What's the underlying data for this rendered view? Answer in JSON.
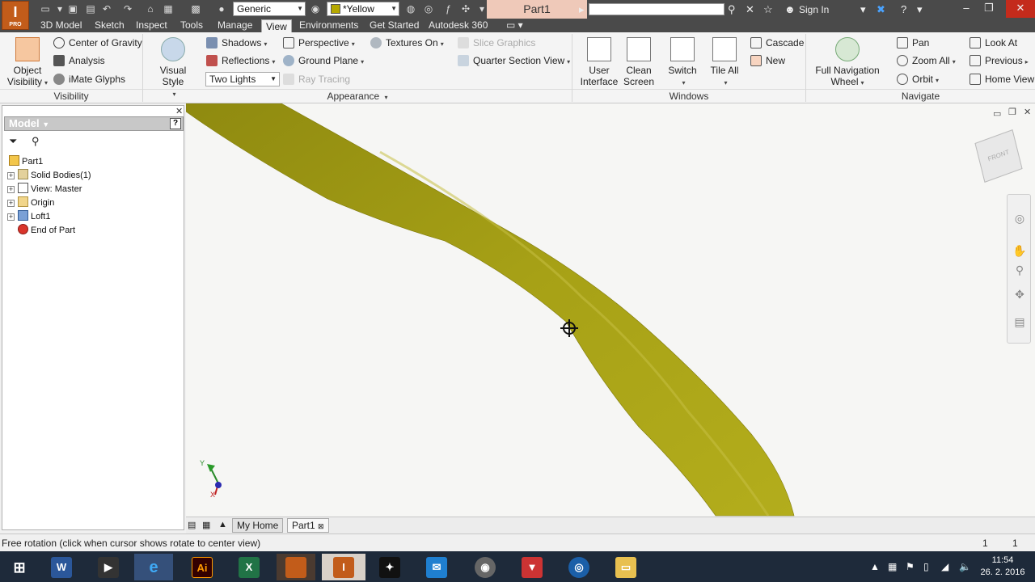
{
  "app": {
    "logo_text": "I",
    "logo_sub": "PRO"
  },
  "quick_access": {
    "material_combo": "Generic",
    "appearance_combo": "*Yellow",
    "appearance_color": "#b5a800"
  },
  "title": {
    "document": "Part1",
    "sign_in": "Sign In"
  },
  "tabs": [
    "3D Model",
    "Sketch",
    "Inspect",
    "Tools",
    "Manage",
    "View",
    "Environments",
    "Get Started",
    "Autodesk 360"
  ],
  "active_tab": "View",
  "ribbon": {
    "visibility": {
      "label": "Visibility",
      "object_visibility": "Object Visibility",
      "center_of_gravity": "Center of Gravity",
      "analysis": "Analysis",
      "imate_glyphs": "iMate Glyphs"
    },
    "appearance": {
      "label": "Appearance",
      "visual_style": "Visual Style",
      "shadows": "Shadows",
      "reflections": "Reflections",
      "lighting": "Two Lights",
      "perspective": "Perspective",
      "ground_plane": "Ground Plane",
      "ray_tracing": "Ray Tracing",
      "textures_on": "Textures On",
      "slice_graphics": "Slice Graphics",
      "quarter_section_view": "Quarter Section View"
    },
    "windows": {
      "label": "Windows",
      "user_interface": "User Interface",
      "clean_screen": "Clean Screen",
      "switch": "Switch",
      "tile_all": "Tile All",
      "cascade": "Cascade",
      "new": "New"
    },
    "navigate": {
      "label": "Navigate",
      "full_navigation_wheel": "Full Navigation Wheel",
      "pan": "Pan",
      "zoom_all": "Zoom All",
      "orbit": "Orbit",
      "look_at": "Look At",
      "previous": "Previous",
      "home_view": "Home View"
    }
  },
  "browser": {
    "title": "Model",
    "help": "?",
    "items": [
      {
        "label": "Part1",
        "expandable": false
      },
      {
        "label": "Solid Bodies(1)",
        "expandable": true
      },
      {
        "label": "View: Master",
        "expandable": true
      },
      {
        "label": "Origin",
        "expandable": true
      },
      {
        "label": "Loft1",
        "expandable": true
      },
      {
        "label": "End of Part",
        "expandable": false
      }
    ]
  },
  "triad": {
    "y": "Y",
    "x": "X"
  },
  "viewcube": {
    "face": "FRONT"
  },
  "doc_tabs": [
    {
      "label": "My Home",
      "active": false
    },
    {
      "label": "Part1",
      "active": true
    }
  ],
  "status": {
    "message": "Free rotation (click when cursor shows rotate to center view)",
    "count1": "1",
    "count2": "1"
  },
  "taskbar": {
    "apps": [
      "windows-start",
      "word",
      "video-editor",
      "internet-explorer",
      "illustrator",
      "excel",
      "app-7",
      "inventor",
      "app-9",
      "outlook",
      "app-11",
      "popcorn",
      "app-13",
      "file-explorer"
    ],
    "time": "11:54",
    "date": "26. 2. 2016"
  }
}
